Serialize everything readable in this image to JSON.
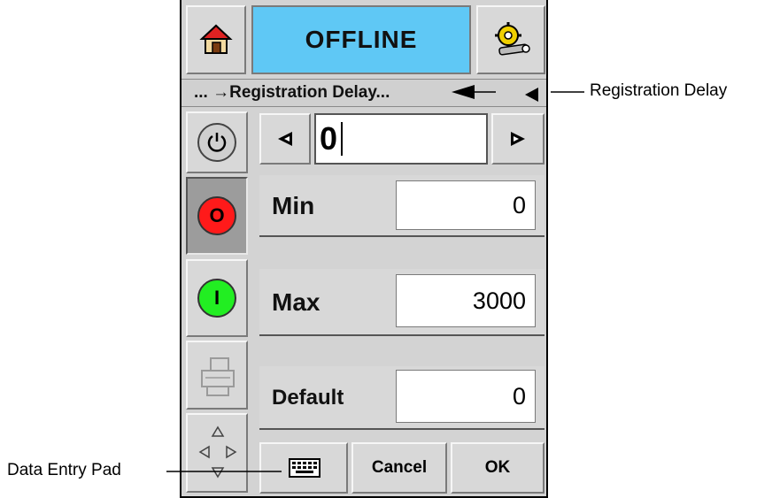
{
  "header": {
    "status": "OFFLINE",
    "home_icon": "home-icon",
    "settings_icon": "tools-settings-icon"
  },
  "breadcrumb": {
    "text": "... →Registration Delay..."
  },
  "value_editor": {
    "value": "0",
    "min_label": "Min",
    "min_value": "0",
    "max_label": "Max",
    "max_value": "3000",
    "default_label": "Default",
    "default_value": "0"
  },
  "sidebar": {
    "power_icon": "power-icon",
    "stop_label": "O",
    "start_label": "I",
    "printer_icon": "printer-icon",
    "navigation_icon": "navigation-arrows-icon"
  },
  "footer": {
    "keyboard_icon": "keyboard-icon",
    "cancel_label": "Cancel",
    "ok_label": "OK"
  },
  "annotations": {
    "registration_delay": "Registration Delay",
    "data_entry_pad": "Data Entry Pad"
  },
  "colors": {
    "status_bg": "#5fc8f5",
    "stop_red": "#ff1a1a",
    "start_green": "#22ee22"
  }
}
